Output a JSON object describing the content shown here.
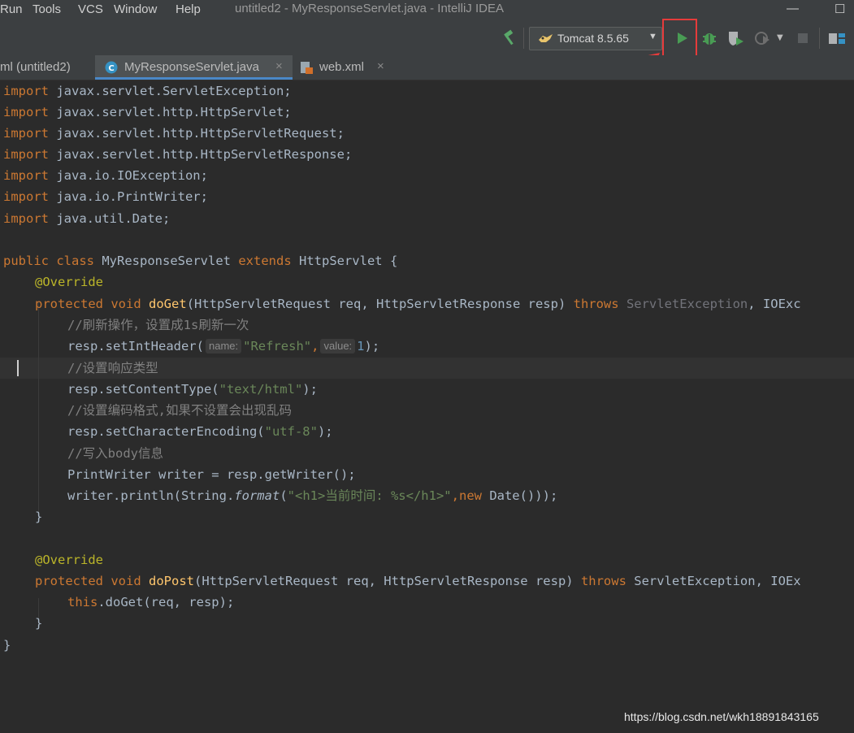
{
  "window": {
    "title": "untitled2 - MyResponseServlet.java - IntelliJ IDEA",
    "menu": [
      "Run",
      "Tools",
      "VCS",
      "Window",
      "Help"
    ]
  },
  "toolbar": {
    "run_config": "Tomcat 8.5.65",
    "icons": [
      "build-hammer-icon",
      "tomcat-icon",
      "run-icon",
      "debug-icon",
      "coverage-icon",
      "profile-icon",
      "stop-icon",
      "project-structure-icon"
    ],
    "accent_highlight": "#e63b3b"
  },
  "tabs": [
    {
      "label": "ml (untitled2)"
    },
    {
      "label": "MyResponseServlet.java",
      "active": true
    },
    {
      "label": "web.xml"
    }
  ],
  "code": {
    "import1": {
      "kw": "import",
      "rest": " javax.servlet.ServletException;"
    },
    "import2": {
      "kw": "import",
      "rest": " javax.servlet.http.HttpServlet;"
    },
    "import3": {
      "kw": "import",
      "rest": " javax.servlet.http.HttpServletRequest;"
    },
    "import4": {
      "kw": "import",
      "rest": " javax.servlet.http.HttpServletResponse;"
    },
    "import5": {
      "kw": "import",
      "rest": " java.io.IOException;"
    },
    "import6": {
      "kw": "import",
      "rest": " java.io.PrintWriter;"
    },
    "import7": {
      "kw": "import",
      "rest": " java.util.Date;"
    },
    "class_public": "public",
    "class_class": "class",
    "class_name": " MyResponseServlet ",
    "class_extends": "extends",
    "class_super": " HttpServlet {",
    "override1": "@Override",
    "doget_protected": "protected",
    "doget_void": "void",
    "doget_name": "doGet",
    "doget_params": "(HttpServletRequest req, HttpServletResponse resp) ",
    "doget_throws": "throws",
    "doget_ex1": " ServletException",
    "doget_ex2": ", IOExc",
    "comment1": "//刷新操作，设置成1s刷新一次",
    "setint_pre": "resp.setIntHeader(",
    "hint_name": "name:",
    "setint_arg1": "\"Refresh\"",
    "setint_comma": ",",
    "hint_value": "value:",
    "setint_arg2": "1",
    "setint_post": ");",
    "comment2": "//设置响应类型",
    "setct_pre": "resp.setContentType(",
    "setct_arg": "\"text/html\"",
    "setct_post": ");",
    "comment3": "//设置编码格式,如果不设置会出现乱码",
    "setenc_pre": "resp.setCharacterEncoding(",
    "setenc_arg": "\"utf-8\"",
    "setenc_post": ");",
    "comment4": "//写入body信息",
    "writer_line": "PrintWriter writer = resp.getWriter();",
    "println_pre": "writer.println(String.",
    "println_format": "format",
    "println_open": "(",
    "println_str": "\"<h1>当前时间: %s</h1>\"",
    "println_comma": ",",
    "println_new": "new",
    "println_post": " Date()));",
    "close_method1": "}",
    "override2": "@Override",
    "dopost_protected": "protected",
    "dopost_void": "void",
    "dopost_name": "doPost",
    "dopost_params": "(HttpServletRequest req, HttpServletResponse resp) ",
    "dopost_throws": "throws",
    "dopost_ex": " ServletException, IOEx",
    "this_kw": "this",
    "this_rest": ".doGet(req, resp);",
    "close_method2": "}",
    "close_class": "}"
  },
  "watermark": "https://blog.csdn.net/wkh18891843165"
}
